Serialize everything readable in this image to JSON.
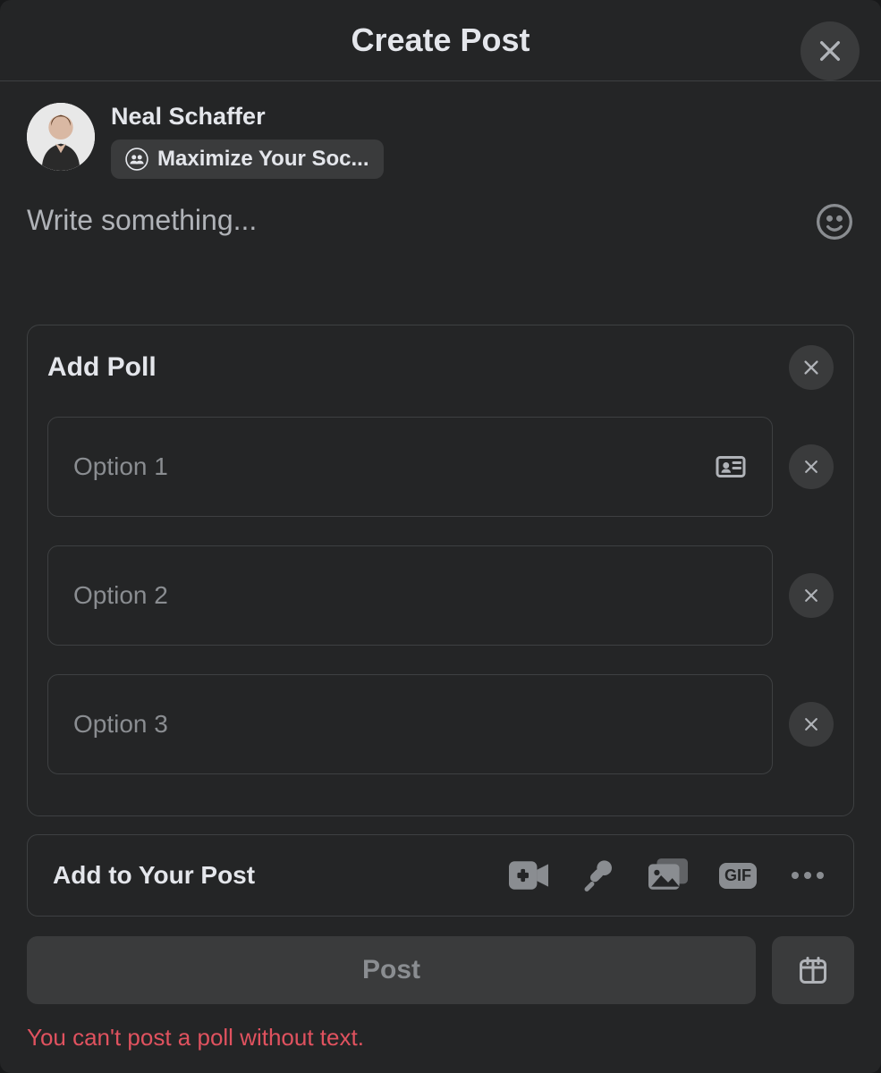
{
  "header": {
    "title": "Create Post"
  },
  "user": {
    "name": "Neal Schaffer",
    "audience_label": "Maximize Your Soc..."
  },
  "composer": {
    "placeholder": "Write something...",
    "value": ""
  },
  "poll": {
    "title": "Add Poll",
    "options": [
      {
        "placeholder": "Option 1",
        "value": "",
        "has_card_icon": true
      },
      {
        "placeholder": "Option 2",
        "value": "",
        "has_card_icon": false
      },
      {
        "placeholder": "Option 3",
        "value": "",
        "has_card_icon": false
      }
    ]
  },
  "add_to_post": {
    "label": "Add to Your Post",
    "gif_label": "GIF"
  },
  "footer": {
    "post_label": "Post"
  },
  "error": {
    "message": "You can't post a poll without text."
  },
  "icons": {
    "close": "close-icon",
    "group": "group-icon",
    "emoji": "emoji-icon",
    "camera": "live-video-icon",
    "mic": "microphone-icon",
    "photo": "photo-video-icon",
    "gif": "gif-icon",
    "more": "more-icon",
    "calendar": "calendar-icon",
    "card": "contact-card-icon"
  }
}
